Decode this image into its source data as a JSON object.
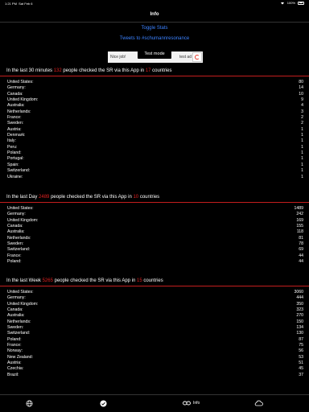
{
  "status": {
    "time": "1:21 PM",
    "date": "Sat Feb 6",
    "battery": "100%"
  },
  "nav": {
    "title": "Info"
  },
  "links": {
    "toggle": "Toggle Stats",
    "tweets": "Tweets to #schumannresonance"
  },
  "ad": {
    "nice": "Nice job!",
    "test_mode": "Test mode",
    "test_ad": "test ad"
  },
  "sections": [
    {
      "prefix": "In the last 30 minutes",
      "count": "132",
      "middle": "people checked the SR via this App in",
      "countries": "17",
      "suffix": "countries",
      "rows": [
        [
          "United States:",
          "80"
        ],
        [
          "Germany:",
          "14"
        ],
        [
          "Canada:",
          "10"
        ],
        [
          "United Kingdom:",
          "9"
        ],
        [
          "Australia:",
          "4"
        ],
        [
          "Netherlands:",
          "3"
        ],
        [
          "France:",
          "2"
        ],
        [
          "Sweden:",
          "2"
        ],
        [
          "Austria:",
          "1"
        ],
        [
          "Denmark:",
          "1"
        ],
        [
          "Italy:",
          "1"
        ],
        [
          "Peru:",
          "1"
        ],
        [
          "Poland:",
          "1"
        ],
        [
          "Portugal:",
          "1"
        ],
        [
          "Spain:",
          "1"
        ],
        [
          "Switzerland:",
          "1"
        ],
        [
          "Ukraine:",
          "1"
        ]
      ]
    },
    {
      "prefix": "In the last Day",
      "count": "2489",
      "middle": "people checked the SR via this App in",
      "countries": "10",
      "suffix": "countries",
      "rows": [
        [
          "United States:",
          "1489"
        ],
        [
          "Germany:",
          "242"
        ],
        [
          "United Kingdom:",
          "169"
        ],
        [
          "Canada:",
          "155"
        ],
        [
          "Australia:",
          "118"
        ],
        [
          "Netherlands:",
          "81"
        ],
        [
          "Sweden:",
          "78"
        ],
        [
          "Switzerland:",
          "69"
        ],
        [
          "France:",
          "44"
        ],
        [
          "Poland:",
          "44"
        ]
      ]
    },
    {
      "prefix": "In the last Week",
      "count": "5265",
      "middle": "people checked the SR via this App in",
      "countries": "15",
      "suffix": "countries",
      "rows": [
        [
          "United States:",
          "3060"
        ],
        [
          "Germany:",
          "444"
        ],
        [
          "United Kingdom:",
          "350"
        ],
        [
          "Canada:",
          "323"
        ],
        [
          "Australia:",
          "270"
        ],
        [
          "Netherlands:",
          "150"
        ],
        [
          "Sweden:",
          "134"
        ],
        [
          "Switzerland:",
          "130"
        ],
        [
          "Poland:",
          "87"
        ],
        [
          "France:",
          "75"
        ],
        [
          "Norway:",
          "56"
        ],
        [
          "New Zealand:",
          "53"
        ],
        [
          "Austria:",
          "51"
        ],
        [
          "Czechia:",
          "45"
        ],
        [
          "Brazil:",
          "37"
        ]
      ]
    }
  ],
  "tabs": {
    "info_label": "Info"
  },
  "colors": {
    "accent_red": "#e02020",
    "link_blue": "#3b82ff",
    "rule_red": "#c41e1e"
  }
}
